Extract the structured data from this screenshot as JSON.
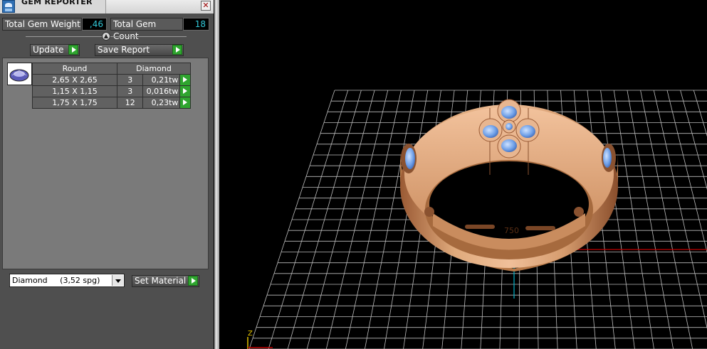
{
  "panel": {
    "title": "GEM REPORTER",
    "close_glyph": "✕",
    "total_weight_label": "Total Gem Weight",
    "total_weight_value": ",46",
    "total_count_label": "Total Gem Count",
    "total_count_value": "18",
    "update_label": "Update",
    "save_report_label": "Save Report",
    "table": {
      "headers": [
        "Round",
        "Diamond"
      ],
      "rows": [
        {
          "size": "2,65 X 2,65",
          "count": "3",
          "weight": "0,21tw"
        },
        {
          "size": "1,15 X 1,15",
          "count": "3",
          "weight": "0,016tw"
        },
        {
          "size": "1,75 X 1,75",
          "count": "12",
          "weight": "0,23tw"
        }
      ]
    },
    "material_select_value": "Diamond     (3,52 spg)",
    "set_material_label": "Set Material"
  },
  "viewport": {
    "axis_label": "Z",
    "ring_stamp": "750",
    "colors": {
      "metal": "#d49a6a",
      "gem": "#6fa0e8",
      "grid": "#c8c8c8",
      "x_axis": "#c00000",
      "y_axis": "#00b0c8"
    }
  },
  "icons": [
    "app-icon",
    "close-icon",
    "play-icon",
    "dropdown-arrow-icon",
    "gem-thumbnail-icon",
    "slider-knob-icon"
  ]
}
